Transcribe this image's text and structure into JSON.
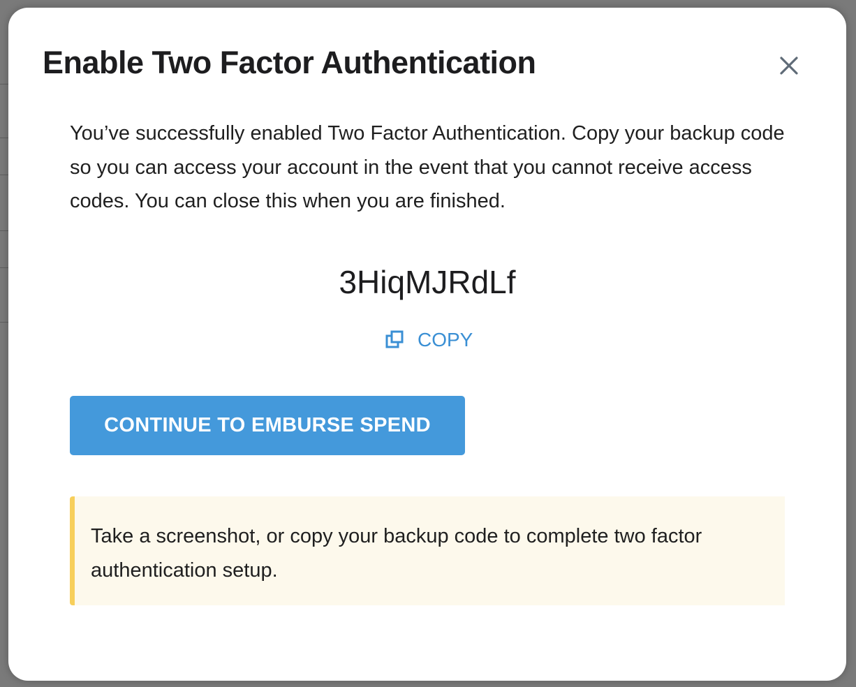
{
  "background": {
    "overlay_color": "#7a7a7a"
  },
  "modal": {
    "title": "Enable Two Factor Authentication",
    "close_icon": "close-icon",
    "intro_text": "You’ve successfully enabled Two Factor Authentication. Copy your backup code so you can access your account in the event that you cannot receive access codes. You can close this when you are finished.",
    "backup_code": "3HiqMJRdLf",
    "copy_label": "COPY",
    "copy_icon": "copy-icon",
    "continue_label": "CONTINUE TO EMBURSE SPEND",
    "notice_text": "Take a screenshot, or copy your backup code to complete two factor authentication setup."
  },
  "colors": {
    "primary": "#4499db",
    "link": "#3a8fd4",
    "notice_background": "#fdf9ec",
    "notice_border": "#f7cf5b",
    "text": "#1d1d1f"
  }
}
